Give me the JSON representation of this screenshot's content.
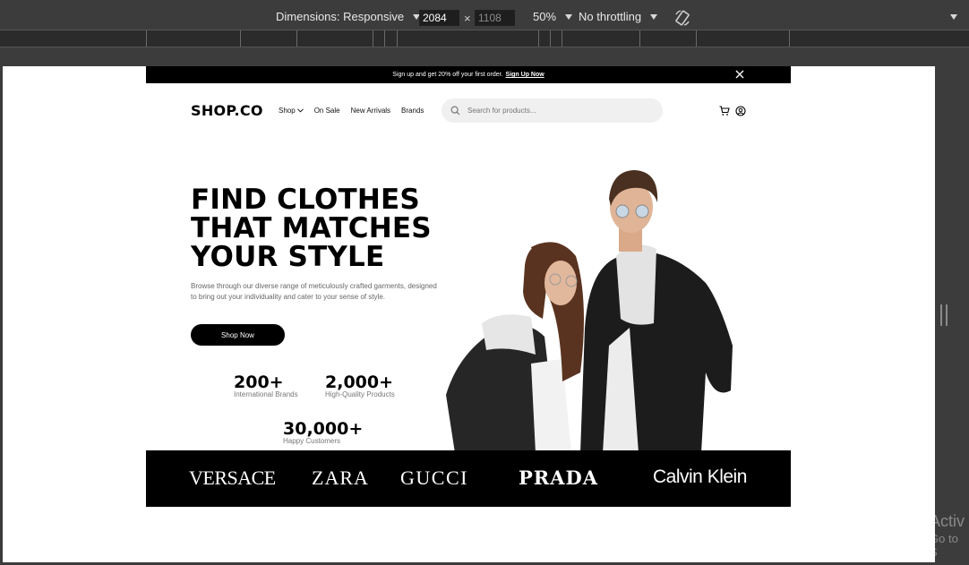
{
  "devtools": {
    "dimensions_label": "Dimensions: Responsive",
    "width_value": "2084",
    "height_value": "1108",
    "times": "×",
    "zoom": "50%",
    "throttling": "No throttling"
  },
  "watermark": {
    "line1": "Activ",
    "line2": "Go to S"
  },
  "site": {
    "promo": {
      "text": "Sign up and get 20% off your first order.",
      "link": "Sign Up Now"
    },
    "logo": "SHOP.CO",
    "nav": {
      "shop": "Shop",
      "on_sale": "On Sale",
      "new_arrivals": "New Arrivals",
      "brands": "Brands"
    },
    "search": {
      "placeholder": "Search for products..."
    },
    "hero": {
      "headline_1": "FIND CLOTHES",
      "headline_2": "THAT MATCHES",
      "headline_3": "YOUR STYLE",
      "subtext": "Browse through our diverse range of meticulously crafted garments, designed to bring out your individuality and cater to your sense of style.",
      "button": "Shop Now"
    },
    "stats": [
      {
        "value": "200+",
        "label": "International Brands"
      },
      {
        "value": "2,000+",
        "label": "High-Quality Products"
      },
      {
        "value": "30,000+",
        "label": "Happy Customers"
      }
    ],
    "brands": [
      "VERSACE",
      "ZARA",
      "GUCCI",
      "PRADA",
      "Calvin Klein"
    ]
  }
}
